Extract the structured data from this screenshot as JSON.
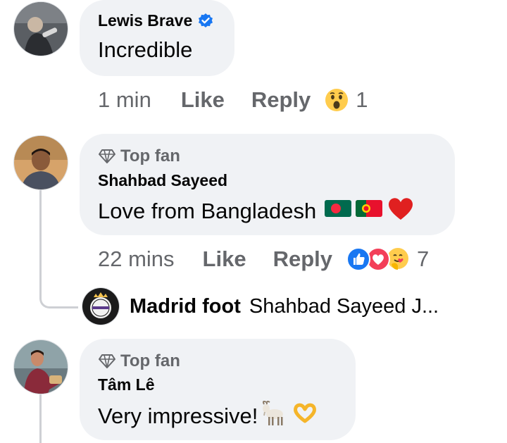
{
  "comments": [
    {
      "author": "Lewis Brave",
      "verified": true,
      "text": "Incredible",
      "time": "1 min",
      "like_label": "Like",
      "reply_label": "Reply",
      "reactions": [
        "wow"
      ],
      "reaction_count": "1"
    },
    {
      "badge": "Top fan",
      "author": "Shahbad Sayeed",
      "text": "Love from Bangladesh",
      "text_emojis": [
        "flag-bangladesh",
        "flag-portugal",
        "red-heart"
      ],
      "time": "22 mins",
      "like_label": "Like",
      "reply_label": "Reply",
      "reactions": [
        "like",
        "love",
        "care"
      ],
      "reaction_count": "7",
      "reply_preview": {
        "author": "Madrid foot",
        "text": "Shahbad Sayeed J..."
      }
    },
    {
      "badge": "Top fan",
      "author": "Tâm Lê",
      "text": "Very impressive!",
      "text_emojis": [
        "goat",
        "heart-hands"
      ]
    }
  ],
  "colors": {
    "bubble_bg": "#f0f2f5",
    "meta_text": "#65676b",
    "verified_blue": "#1877f2",
    "like_blue": "#1877f2",
    "love_red": "#f33e58",
    "thread_line": "#ced0d4"
  }
}
